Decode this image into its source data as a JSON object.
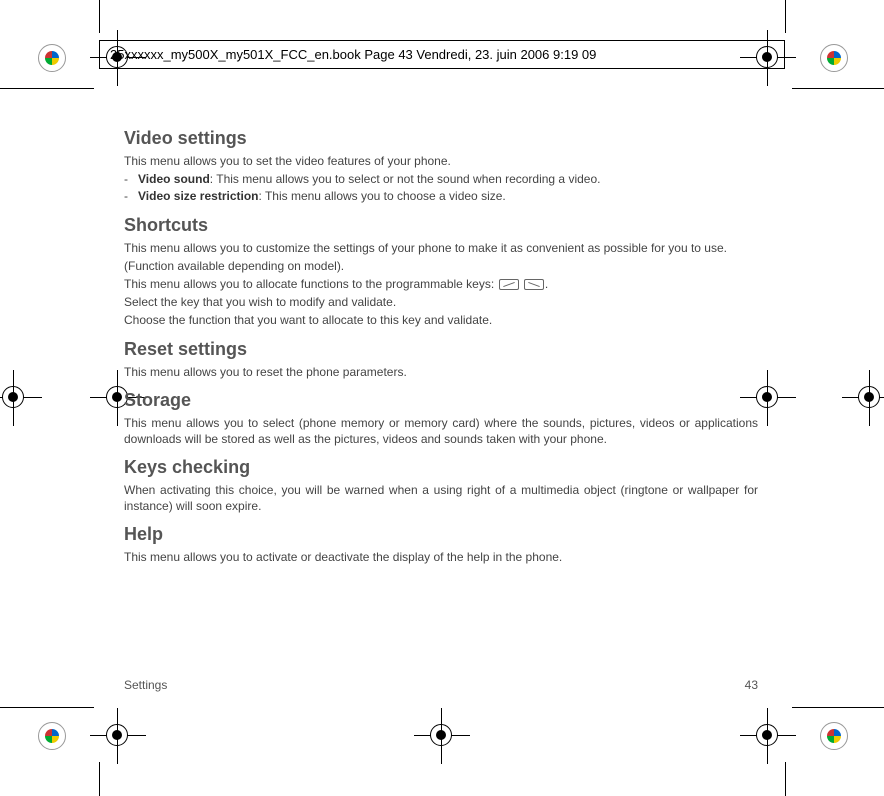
{
  "header": {
    "banner": "25xxxxxx_my500X_my501X_FCC_en.book  Page 43  Vendredi, 23. juin 2006  9:19 09"
  },
  "sections": {
    "video": {
      "title": "Video settings",
      "intro": "This menu allows you to set the video features of your phone.",
      "item1_bold": "Video sound",
      "item1_rest": ": This menu allows you to select or not the sound when recording a video.",
      "item2_bold": "Video size restriction",
      "item2_rest": ": This menu allows you to choose a video size."
    },
    "shortcuts": {
      "title": "Shortcuts",
      "p1": "This menu allows you to customize the settings of your phone to make it as convenient as possible for you to use.",
      "p2": "(Function available depending on model).",
      "p3a": "This menu allows you to allocate functions to the programmable keys: ",
      "p3b": ".",
      "p4": "Select the key that you wish to modify and validate.",
      "p5": "Choose the function that you want to allocate to this key and validate."
    },
    "reset": {
      "title": "Reset settings",
      "p1": "This menu allows you to reset the phone parameters."
    },
    "storage": {
      "title": "Storage",
      "p1": "This menu allows you to select (phone memory or memory card) where the sounds, pictures, videos or applications downloads will be stored as well as the pictures, videos and sounds taken with your phone."
    },
    "keys": {
      "title": "Keys checking",
      "p1": "When activating this choice, you will be warned when a using right of a multimedia object (ringtone or wallpaper for instance) will soon expire."
    },
    "help": {
      "title": "Help",
      "p1": "This menu allows you to activate or deactivate the display of the help in the phone."
    }
  },
  "footer": {
    "left": "Settings",
    "right": "43"
  }
}
